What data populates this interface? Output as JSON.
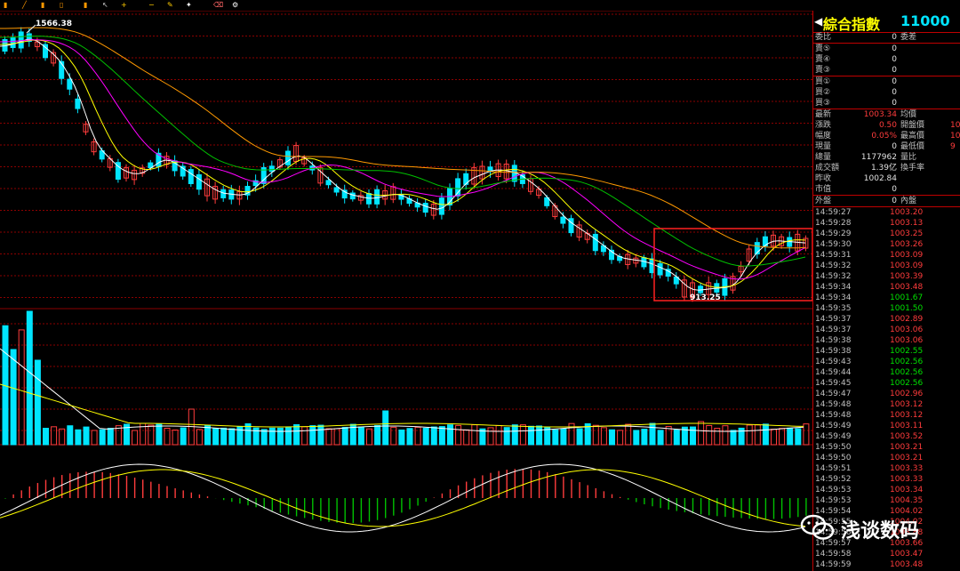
{
  "colors": {
    "up": "#ff3c3c",
    "down": "#00e5ff",
    "ma5": "#ffffff",
    "ma10": "#ffff00",
    "ma20": "#ff00ff",
    "ma30": "#00c000",
    "ma60": "#ff9900",
    "grid": "#8b0000",
    "highlight": "#ff2020"
  },
  "toolbar": {
    "icons": [
      "sort-icon",
      "line-icon",
      "bar-icon",
      "candle-icon",
      "volume-icon",
      "cursor-icon",
      "zoom-in-icon",
      "zoom-out-icon",
      "draw-icon",
      "pin-icon",
      "erase-icon",
      "settings-icon"
    ]
  },
  "panel": {
    "title_name": "綜合指數",
    "title_code": "11000",
    "weibi": {
      "label": "委比",
      "value": "0",
      "label2": "委差"
    },
    "sell": [
      {
        "label": "賣⑤",
        "value": "0"
      },
      {
        "label": "賣④",
        "value": "0"
      },
      {
        "label": "賣③",
        "value": "0"
      }
    ],
    "buy": [
      {
        "label": "買①",
        "value": "0"
      },
      {
        "label": "買②",
        "value": "0"
      },
      {
        "label": "買③",
        "value": "0"
      }
    ],
    "stats": [
      {
        "label": "最新",
        "value": "1003.34",
        "label2": "均價",
        "value2": ""
      },
      {
        "label": "漲跌",
        "value": "0.50",
        "label2": "開盤價",
        "value2": "10"
      },
      {
        "label": "幅度",
        "value": "0.05%",
        "label2": "最高價",
        "value2": "10"
      },
      {
        "label": "現量",
        "value": "0",
        "label2": "最低價",
        "value2": "9"
      },
      {
        "label": "總量",
        "value": "1177962",
        "label2": "量比",
        "value2": ""
      },
      {
        "label": "成交額",
        "value": "1.39亿",
        "label2": "換手率",
        "value2": ""
      },
      {
        "label": "昨收",
        "value": "1002.84",
        "label2": "",
        "value2": ""
      },
      {
        "label": "市值",
        "value": "0",
        "label2": "",
        "value2": ""
      }
    ],
    "outer": {
      "label": "外盤",
      "value": "0",
      "label2": "內盤"
    },
    "ticks": [
      {
        "time": "14:59:27",
        "price": "1003.20",
        "dir": "red"
      },
      {
        "time": "14:59:28",
        "price": "1003.13",
        "dir": "red"
      },
      {
        "time": "14:59:29",
        "price": "1003.25",
        "dir": "red"
      },
      {
        "time": "14:59:30",
        "price": "1003.26",
        "dir": "red"
      },
      {
        "time": "14:59:31",
        "price": "1003.09",
        "dir": "red"
      },
      {
        "time": "14:59:32",
        "price": "1003.09",
        "dir": "red"
      },
      {
        "time": "14:59:32",
        "price": "1003.39",
        "dir": "red"
      },
      {
        "time": "14:59:34",
        "price": "1003.48",
        "dir": "red"
      },
      {
        "time": "14:59:34",
        "price": "1001.67",
        "dir": "green"
      },
      {
        "time": "14:59:35",
        "price": "1001.50",
        "dir": "green"
      },
      {
        "time": "14:59:37",
        "price": "1002.89",
        "dir": "red"
      },
      {
        "time": "14:59:37",
        "price": "1003.06",
        "dir": "red"
      },
      {
        "time": "14:59:38",
        "price": "1003.06",
        "dir": "red"
      },
      {
        "time": "14:59:38",
        "price": "1002.55",
        "dir": "green"
      },
      {
        "time": "14:59:43",
        "price": "1002.56",
        "dir": "green"
      },
      {
        "time": "14:59:44",
        "price": "1002.56",
        "dir": "green"
      },
      {
        "time": "14:59:45",
        "price": "1002.56",
        "dir": "green"
      },
      {
        "time": "14:59:47",
        "price": "1002.96",
        "dir": "red"
      },
      {
        "time": "14:59:48",
        "price": "1003.12",
        "dir": "red"
      },
      {
        "time": "14:59:48",
        "price": "1003.12",
        "dir": "red"
      },
      {
        "time": "14:59:49",
        "price": "1003.11",
        "dir": "red"
      },
      {
        "time": "14:59:49",
        "price": "1003.52",
        "dir": "red"
      },
      {
        "time": "14:59:50",
        "price": "1003.21",
        "dir": "red"
      },
      {
        "time": "14:59:50",
        "price": "1003.21",
        "dir": "red"
      },
      {
        "time": "14:59:51",
        "price": "1003.33",
        "dir": "red"
      },
      {
        "time": "14:59:52",
        "price": "1003.33",
        "dir": "red"
      },
      {
        "time": "14:59:53",
        "price": "1003.34",
        "dir": "red"
      },
      {
        "time": "14:59:53",
        "price": "1004.35",
        "dir": "red"
      },
      {
        "time": "14:59:54",
        "price": "1004.02",
        "dir": "red"
      },
      {
        "time": "14:59:55",
        "price": "1004.02",
        "dir": "red"
      },
      {
        "time": "14:59:56",
        "price": "1003.88",
        "dir": "red"
      },
      {
        "time": "14:59:57",
        "price": "1003.66",
        "dir": "red"
      },
      {
        "time": "14:59:58",
        "price": "1003.47",
        "dir": "red"
      },
      {
        "time": "14:59:59",
        "price": "1003.48",
        "dir": "red"
      }
    ]
  },
  "chart_labels": {
    "high": "1566.38",
    "low": "913.25"
  },
  "watermark": {
    "text": "浅谈数码",
    "icon": "wechat-icon"
  }
}
